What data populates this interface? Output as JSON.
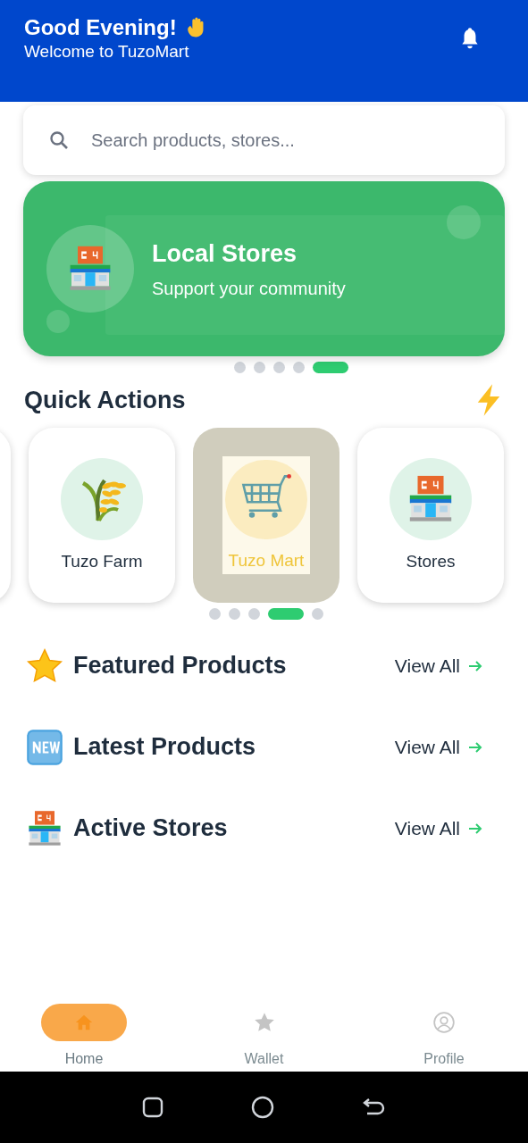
{
  "header": {
    "greeting": "Good Evening!",
    "subtitle": "Welcome to TuzoMart"
  },
  "search": {
    "placeholder": "Search products, stores..."
  },
  "banner": {
    "title": "Local Stores",
    "subtitle": "Support your community",
    "dots": [
      {
        "selected": false
      },
      {
        "selected": false
      },
      {
        "selected": false
      },
      {
        "selected": false
      },
      {
        "selected": true
      }
    ]
  },
  "quick_actions": {
    "title": "Quick Actions",
    "items": [
      {
        "kind": "partial",
        "selected": false
      },
      {
        "kind": "farm",
        "label": "Tuzo Farm",
        "selected": false
      },
      {
        "kind": "cart",
        "label": "Tuzo Mart",
        "selected": true
      },
      {
        "kind": "store",
        "label": "Stores",
        "selected": false
      }
    ],
    "dots": [
      {
        "selected": false
      },
      {
        "selected": false
      },
      {
        "selected": false
      },
      {
        "selected": true
      },
      {
        "selected": false
      }
    ]
  },
  "sections": [
    {
      "kind": "star",
      "title": "Featured Products",
      "link": "View All"
    },
    {
      "kind": "new",
      "title": "Latest Products",
      "link": "View All"
    },
    {
      "kind": "store",
      "title": "Active Stores",
      "link": "View All"
    }
  ],
  "bottom_nav": [
    {
      "kind": "home",
      "label": "Home",
      "selected": true
    },
    {
      "kind": "star",
      "label": "Wallet",
      "selected": false
    },
    {
      "kind": "profile",
      "label": "Profile",
      "selected": false
    }
  ]
}
